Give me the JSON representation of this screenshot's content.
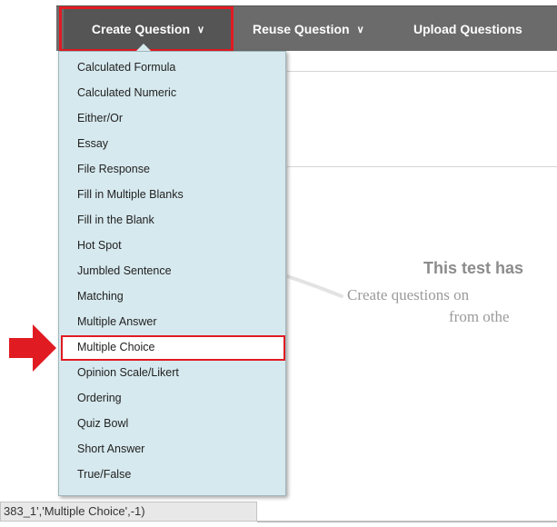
{
  "toolbar": {
    "create_question": "Create Question",
    "reuse_question": "Reuse Question",
    "upload_questions": "Upload Questions",
    "chevron": "∨"
  },
  "menu": {
    "items": [
      "Calculated Formula",
      "Calculated Numeric",
      "Either/Or",
      "Essay",
      "File Response",
      "Fill in Multiple Blanks",
      "Fill in the Blank",
      "Hot Spot",
      "Jumbled Sentence",
      "Matching",
      "Multiple Answer",
      "Multiple Choice",
      "Opinion Scale/Likert",
      "Ordering",
      "Quiz Bowl",
      "Short Answer",
      "True/False"
    ],
    "highlighted_item": "Multiple Choice"
  },
  "background": {
    "empty_title": "This test has",
    "empty_line1": "Create questions on",
    "empty_line2": "from othe"
  },
  "status_bar": {
    "text": "383_1','Multiple Choice',-1)"
  },
  "colors": {
    "highlight_red": "#e11b22",
    "menu_bg": "#d6e9ee",
    "toolbar_bg": "#6b6b6b"
  }
}
